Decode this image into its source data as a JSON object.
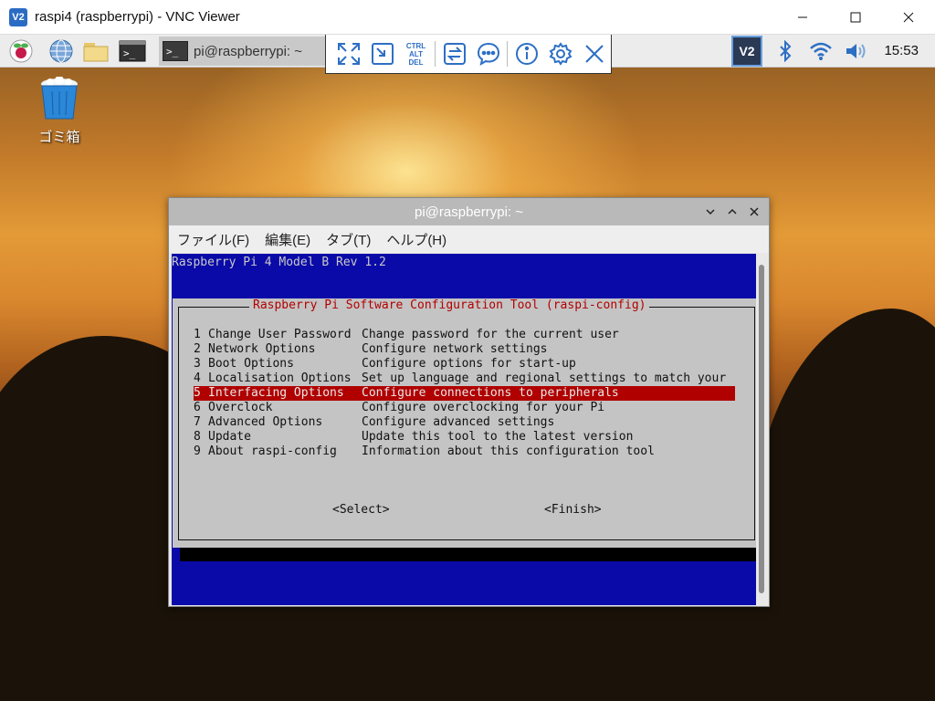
{
  "window": {
    "app_icon_text": "V2",
    "title": "raspi4 (raspberrypi) - VNC Viewer",
    "controls": [
      "minimize-icon",
      "maximize-icon",
      "close-icon"
    ]
  },
  "taskbar": {
    "launchers": [
      "raspberry-menu-icon",
      "web-browser-icon",
      "file-manager-icon",
      "terminal-icon"
    ],
    "task": {
      "icon_text": ">_",
      "label": "pi@raspberrypi: ~"
    },
    "tray": [
      "vnc-server-icon",
      "bluetooth-icon",
      "wifi-icon",
      "volume-icon"
    ],
    "vnc_tray_text": "V2",
    "clock": "15:53"
  },
  "vnc_toolbar": {
    "buttons": [
      "fullscreen-icon",
      "scale-icon",
      "ctrl-alt-del-icon",
      "transfer-files-icon",
      "chat-icon",
      "info-icon",
      "settings-icon",
      "close-toolbar-icon"
    ],
    "ctrl_alt_del_text": [
      "CTRL",
      "ALT",
      "DEL"
    ]
  },
  "desktop": {
    "trash_label": "ゴミ箱"
  },
  "terminal": {
    "title": "pi@raspberrypi: ~",
    "menus": [
      "ファイル(F)",
      "編集(E)",
      "タブ(T)",
      "ヘルプ(H)"
    ],
    "header_line": "Raspberry Pi 4 Model B Rev 1.2",
    "dialog_title": "Raspberry Pi Software Configuration Tool (raspi-config)",
    "items": [
      {
        "num": "1",
        "name": "Change User Password",
        "desc": "Change password for the current user"
      },
      {
        "num": "2",
        "name": "Network Options",
        "desc": "Configure network settings"
      },
      {
        "num": "3",
        "name": "Boot Options",
        "desc": "Configure options for start-up"
      },
      {
        "num": "4",
        "name": "Localisation Options",
        "desc": "Set up language and regional settings to match your"
      },
      {
        "num": "5",
        "name": "Interfacing Options",
        "desc": "Configure connections to peripherals"
      },
      {
        "num": "6",
        "name": "Overclock",
        "desc": "Configure overclocking for your Pi"
      },
      {
        "num": "7",
        "name": "Advanced Options",
        "desc": "Configure advanced settings"
      },
      {
        "num": "8",
        "name": "Update",
        "desc": "Update this tool to the latest version"
      },
      {
        "num": "9",
        "name": "About raspi-config",
        "desc": "Information about this configuration tool"
      }
    ],
    "selected_index": 4,
    "select_button": "<Select>",
    "finish_button": "<Finish>"
  },
  "colors": {
    "terminal_bg": "#0a0aa8",
    "dialog_bg": "#c4c4c4",
    "selection": "#b00000",
    "dialog_title": "#b30000",
    "vnc_accent": "#2d6fc4"
  }
}
